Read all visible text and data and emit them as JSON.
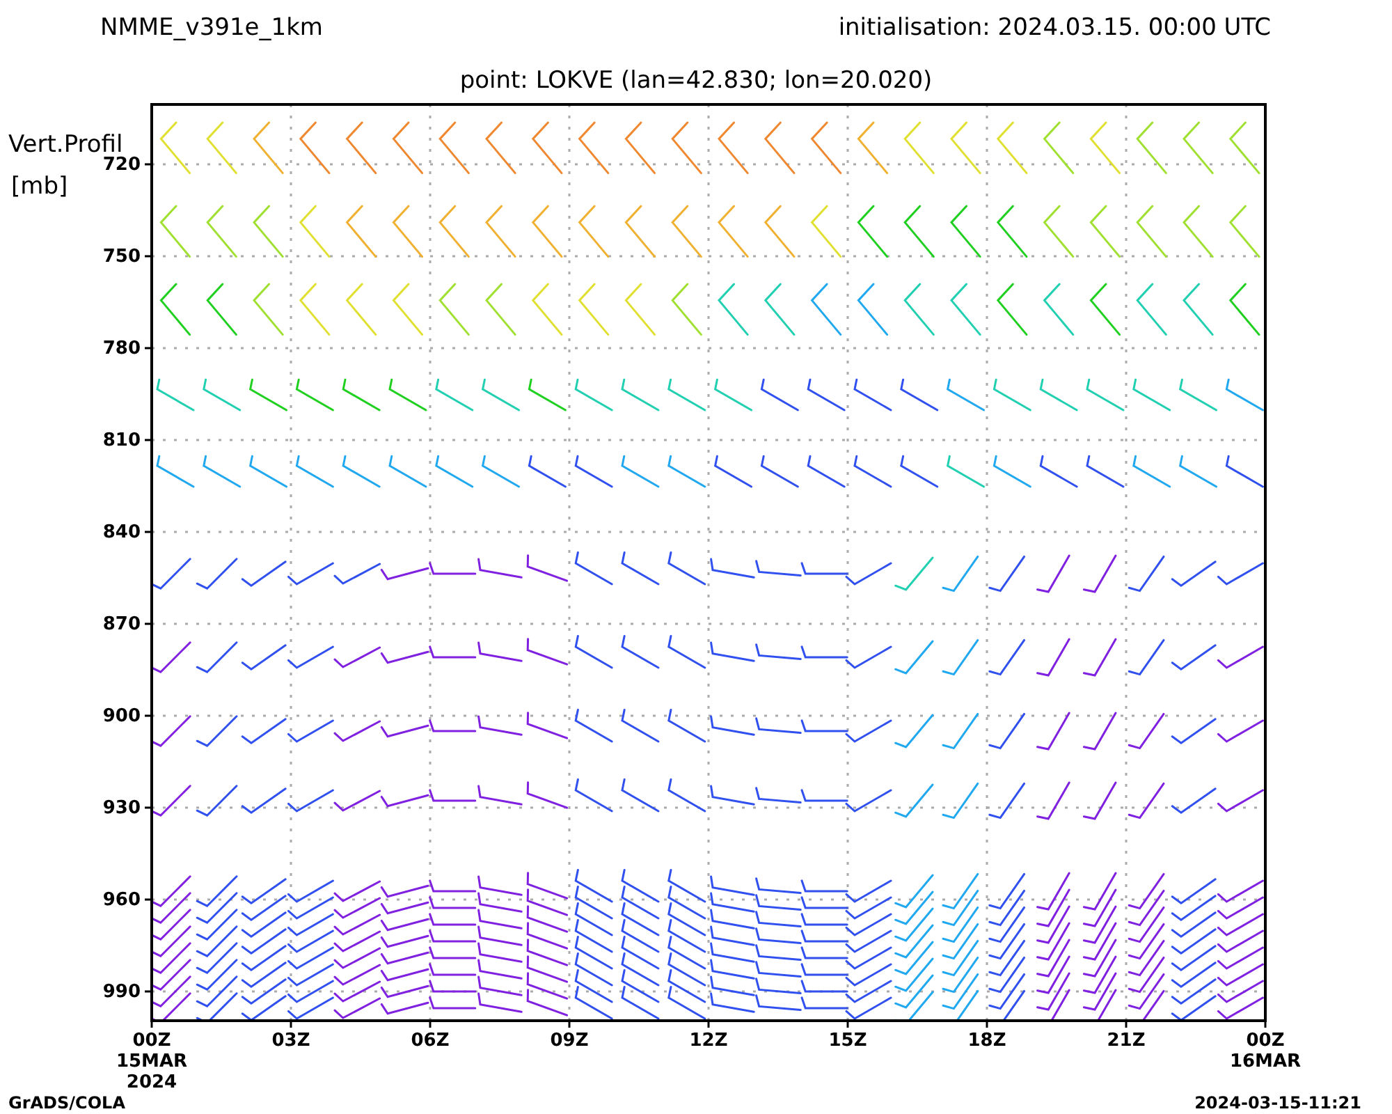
{
  "header": {
    "model": "NMME_v391e_1km",
    "initialisation": "initialisation: 2024.03.15. 00:00 UTC"
  },
  "subtitle": "point: LOKVE (lan=42.830; lon=20.020)",
  "y_axis": {
    "title_lines": [
      "Vert.Profil",
      "[mb]"
    ],
    "ticks": [
      "720",
      "750",
      "780",
      "810",
      "840",
      "870",
      "900",
      "930",
      "960",
      "990"
    ]
  },
  "x_axis": {
    "ticks": [
      {
        "label": "00Z",
        "date_lines": [
          "15MAR",
          "2024"
        ]
      },
      {
        "label": "03Z"
      },
      {
        "label": "06Z"
      },
      {
        "label": "09Z"
      },
      {
        "label": "12Z"
      },
      {
        "label": "15Z"
      },
      {
        "label": "18Z"
      },
      {
        "label": "21Z"
      },
      {
        "label": "00Z",
        "date_lines": [
          "16MAR"
        ]
      }
    ]
  },
  "footer": {
    "left": "GrADS/COLA",
    "right": "2024-03-15-11:21"
  }
}
